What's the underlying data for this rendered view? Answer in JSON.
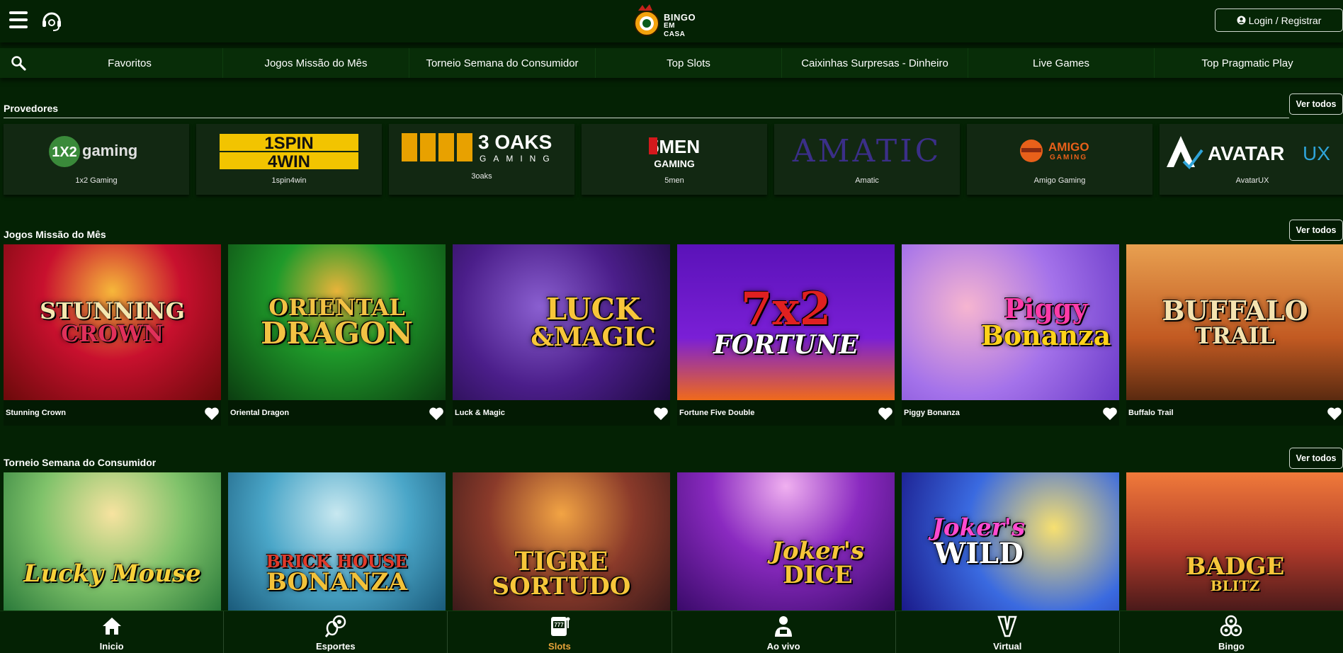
{
  "header": {
    "menu_icon": "hamburger-menu-icon",
    "support_icon": "headset-support-icon",
    "logo": {
      "line1": "BINGO",
      "line2": "EM CASA"
    },
    "login_label": "Login / Registrar",
    "login_icon": "user-circle-icon"
  },
  "categories": {
    "search_icon": "search-icon",
    "items": [
      {
        "label": "Favoritos"
      },
      {
        "label": "Jogos Missão do Mês"
      },
      {
        "label": "Torneio Semana do Consumidor"
      },
      {
        "label": "Top Slots"
      },
      {
        "label": "Caixinhas Surpresas - Dinheiro"
      },
      {
        "label": "Live Games"
      },
      {
        "label": "Top Pragmatic Play"
      }
    ]
  },
  "providers": {
    "title": "Provedores",
    "see_all": "Ver todos",
    "items": [
      {
        "name": "1x2 Gaming",
        "logo_a": "1X2",
        "logo_b": "gaming"
      },
      {
        "name": "1spin4win",
        "logo_a": "1SPIN",
        "logo_b": "4WIN"
      },
      {
        "name": "3oaks",
        "logo_a": "3 OAKS",
        "logo_b": "GAMING"
      },
      {
        "name": "5men",
        "logo_a": "5MEN",
        "logo_b": "GAMING"
      },
      {
        "name": "Amatic",
        "logo_a": "AMATIC",
        "logo_b": ""
      },
      {
        "name": "Amigo Gaming",
        "logo_a": "AMIGO",
        "logo_b": "GAMING"
      },
      {
        "name": "AvatarUX",
        "logo_a": "AVATAR",
        "logo_b": "UX"
      }
    ]
  },
  "mission": {
    "title": "Jogos Missão do Mês",
    "see_all": "Ver todos",
    "games": [
      {
        "name": "Stunning Crown",
        "art_a": "STUNNING",
        "art_b": "CROWN"
      },
      {
        "name": "Oriental Dragon",
        "art_a": "ORIENTAL",
        "art_b": "DRAGON"
      },
      {
        "name": "Luck & Magic",
        "art_a": "LUCK",
        "art_b": "&MAGIC"
      },
      {
        "name": "Fortune Five Double",
        "art_a": "7x2",
        "art_b": "FORTUNE"
      },
      {
        "name": "Piggy Bonanza",
        "art_a": "Piggy",
        "art_b": "Bonanza"
      },
      {
        "name": "Buffalo Trail",
        "art_a": "BUFFALO",
        "art_b": "TRAIL"
      }
    ]
  },
  "tournament": {
    "title": "Torneio Semana do Consumidor",
    "see_all": "Ver todos",
    "games": [
      {
        "art_a": "Lucky",
        "art_b": "Mouse"
      },
      {
        "art_a": "BRICK HOUSE",
        "art_b": "BONANZA"
      },
      {
        "art_a": "TIGRE",
        "art_b": "SORTUDO"
      },
      {
        "art_a": "Joker's",
        "art_b": "DICE"
      },
      {
        "art_a": "Joker's",
        "art_b": "WILD"
      },
      {
        "art_a": "BADGE",
        "art_b": "BLITZ"
      }
    ]
  },
  "bottom_nav": [
    {
      "label": "Inicio",
      "icon": "home-icon"
    },
    {
      "label": "Esportes",
      "icon": "sports-balls-icon"
    },
    {
      "label": "Slots",
      "icon": "slot-machine-icon"
    },
    {
      "label": "Ao vivo",
      "icon": "live-dealer-icon"
    },
    {
      "label": "Virtual",
      "icon": "virtual-v-icon"
    },
    {
      "label": "Bingo",
      "icon": "bingo-balls-icon"
    }
  ],
  "colors": {
    "background": "#042204",
    "active_nav": "#e8a43a",
    "card": "#122812"
  }
}
